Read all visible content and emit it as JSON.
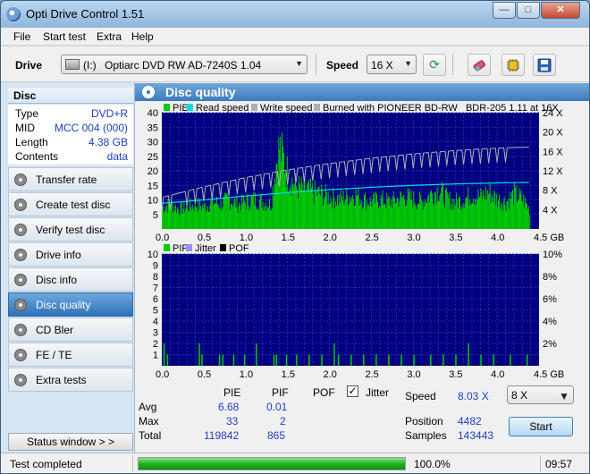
{
  "window": {
    "title": "Opti Drive Control 1.51",
    "min": "—",
    "max": "□",
    "close": "✕"
  },
  "menu": {
    "file": "File",
    "start_test": "Start test",
    "extra": "Extra",
    "help": "Help"
  },
  "toolbar": {
    "drive_label": "Drive",
    "drive_letter": "(I:)",
    "drive_name": "Optiarc DVD RW AD-7240S 1.04",
    "speed_label": "Speed",
    "speed_value": "16 X",
    "icons": [
      "refresh-icon",
      "eraser-icon",
      "chip-icon",
      "save-icon"
    ]
  },
  "disc": {
    "header": "Disc",
    "rows": [
      {
        "key": "Type",
        "value": "DVD+R"
      },
      {
        "key": "MID",
        "value": "MCC 004 (000)"
      },
      {
        "key": "Length",
        "value": "4.38 GB"
      },
      {
        "key": "Contents",
        "value": "data"
      }
    ]
  },
  "nav": [
    {
      "label": "Transfer rate",
      "active": false
    },
    {
      "label": "Create test disc",
      "active": false
    },
    {
      "label": "Verify test disc",
      "active": false
    },
    {
      "label": "Drive info",
      "active": false
    },
    {
      "label": "Disc info",
      "active": false
    },
    {
      "label": "Disc quality",
      "active": true
    },
    {
      "label": "CD Bler",
      "active": false
    },
    {
      "label": "FE / TE",
      "active": false
    },
    {
      "label": "Extra tests",
      "active": false
    }
  ],
  "status_window_button": "Status window > >",
  "panel": {
    "title": "Disc quality"
  },
  "colors": {
    "pie": "#00cc00",
    "read_speed": "#00e0e0",
    "write_speed": "#b0b0b0",
    "pif": "#00cc00",
    "jitter": "#9a8cff",
    "pof": "#000000",
    "plot_bg": "#000080"
  },
  "chart_data": [
    {
      "type": "area",
      "legend": [
        "PIE",
        "Read speed",
        "Write speed",
        "Burned with PIONEER BD-RW   BDR-205 1.11 at 16X"
      ],
      "x_ticks": [
        "0.0",
        "0.5",
        "1.0",
        "1.5",
        "2.0",
        "2.5",
        "3.0",
        "3.5",
        "4.0",
        "4.5 GB"
      ],
      "y_ticks_left": [
        "5",
        "10",
        "15",
        "20",
        "25",
        "30",
        "35",
        "40"
      ],
      "y_ticks_right": [
        "4 X",
        "8 X",
        "12 X",
        "16 X",
        "20 X",
        "24 X"
      ],
      "xlim": [
        0,
        4.5
      ],
      "ylim": [
        0,
        40
      ],
      "y2lim": [
        0,
        24
      ],
      "series": [
        {
          "name": "PIE",
          "x": [
            0.0,
            0.1,
            0.2,
            0.3,
            0.4,
            0.5,
            0.6,
            0.7,
            0.8,
            0.9,
            1.0,
            1.1,
            1.2,
            1.3,
            1.35,
            1.4,
            1.45,
            1.5,
            1.6,
            1.7,
            1.8,
            1.9,
            2.0,
            2.1,
            2.2,
            2.3,
            2.4,
            2.5,
            2.6,
            2.7,
            2.8,
            2.9,
            3.0,
            3.1,
            3.2,
            3.3,
            3.4,
            3.5,
            3.6,
            3.7,
            3.8,
            3.9,
            4.0,
            4.1,
            4.2,
            4.3,
            4.38
          ],
          "y": [
            9,
            10,
            8,
            9,
            10,
            9,
            11,
            10,
            12,
            10,
            11,
            12,
            11,
            10,
            25,
            33,
            28,
            22,
            17,
            16,
            15,
            14,
            13,
            12,
            13,
            14,
            12,
            11,
            12,
            11,
            12,
            13,
            12,
            11,
            14,
            16,
            12,
            11,
            12,
            14,
            13,
            15,
            12,
            11,
            14,
            12,
            8
          ]
        },
        {
          "name": "Read speed",
          "x": [
            0.0,
            0.5,
            1.0,
            1.5,
            2.0,
            2.5,
            3.0,
            3.5,
            4.0,
            4.38
          ],
          "y": [
            5.3,
            6.0,
            6.8,
            7.5,
            8.1,
            8.6,
            9.0,
            9.3,
            9.5,
            9.6
          ]
        },
        {
          "name": "Write speed",
          "x": [
            0.0,
            0.5,
            1.0,
            1.5,
            2.0,
            2.5,
            3.0,
            3.5,
            4.0,
            4.38
          ],
          "y": [
            6.5,
            8.7,
            10.6,
            12.2,
            13.5,
            14.6,
            15.5,
            16.2,
            16.7,
            16.9
          ]
        }
      ]
    },
    {
      "type": "bar",
      "legend": [
        "PIF",
        "Jitter",
        "POF"
      ],
      "x_ticks": [
        "0.0",
        "0.5",
        "1.0",
        "1.5",
        "2.0",
        "2.5",
        "3.0",
        "3.5",
        "4.0",
        "4.5 GB"
      ],
      "y_ticks_left": [
        "1",
        "2",
        "3",
        "4",
        "5",
        "6",
        "7",
        "8",
        "9",
        "10"
      ],
      "y_ticks_right": [
        "2%",
        "4%",
        "6%",
        "8%",
        "10%"
      ],
      "xlim": [
        0,
        4.5
      ],
      "ylim": [
        0,
        10
      ],
      "series": [
        {
          "name": "PIF",
          "x": [
            0.02,
            0.06,
            0.44,
            0.47,
            0.68,
            0.72,
            0.85,
            0.98,
            1.12,
            1.33,
            1.36,
            1.48,
            1.6,
            1.75,
            1.9,
            2.05,
            2.1,
            2.25,
            2.4,
            2.55,
            2.7,
            2.85,
            3.0,
            3.2,
            3.35,
            3.5,
            3.65,
            3.8,
            3.95,
            4.15,
            4.35
          ],
          "y": [
            2,
            1,
            2,
            1,
            1,
            1,
            1,
            1,
            2,
            1,
            1,
            1,
            1,
            1,
            1,
            2,
            1,
            1,
            1,
            1,
            1,
            1,
            1,
            1,
            1,
            1,
            2,
            1,
            1,
            1,
            1
          ]
        }
      ]
    }
  ],
  "stats": {
    "headers": {
      "pie": "PIE",
      "pif": "PIF",
      "pof": "POF",
      "jitter": "Jitter"
    },
    "avg_label": "Avg",
    "max_label": "Max",
    "total_label": "Total",
    "pie": {
      "avg": "6.68",
      "max": "33",
      "total": "119842"
    },
    "pif": {
      "avg": "0.01",
      "max": "2",
      "total": "865"
    },
    "jitter_checked": true,
    "speed_label": "Speed",
    "speed_value": "8.03 X",
    "speed_select": "8 X",
    "position_label": "Position",
    "position_value": "4482",
    "samples_label": "Samples",
    "samples_value": "143443",
    "start_button": "Start"
  },
  "statusbar": {
    "text": "Test completed",
    "progress": 1.0,
    "percent": "100.0%",
    "time": "09:57"
  }
}
